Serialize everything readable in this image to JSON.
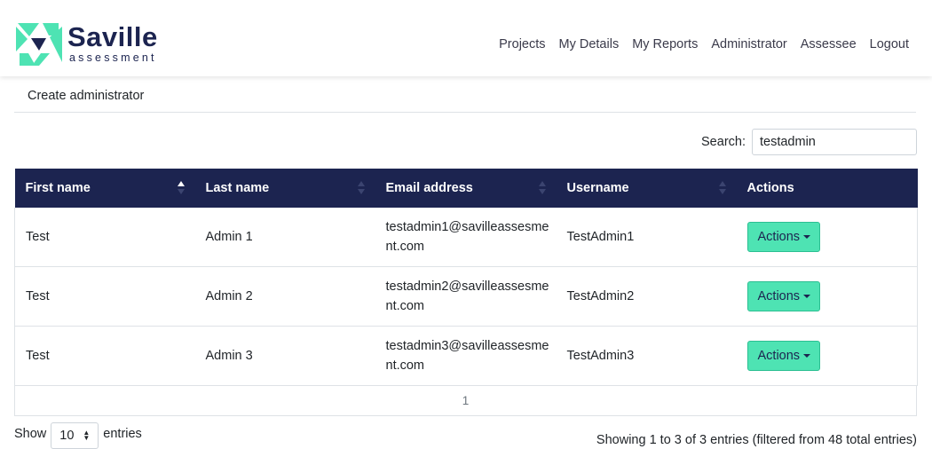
{
  "brand": {
    "name": "Saville",
    "sub": "assessment",
    "accent": "#4ee3b3",
    "navy": "#1c2450"
  },
  "nav": [
    "Projects",
    "My Details",
    "My Reports",
    "Administrator",
    "Assessee",
    "Logout"
  ],
  "breadcrumb": {
    "label": "Create administrator"
  },
  "search": {
    "label": "Search:",
    "value": "testadmin"
  },
  "table": {
    "headers": [
      "First name",
      "Last name",
      "Email address",
      "Username",
      "Actions"
    ],
    "sort_icons": [
      "sort-asc-icon",
      "sort-both-icon",
      "sort-both-icon",
      "sort-both-icon"
    ],
    "rows": [
      {
        "first": "Test",
        "last": "Admin 1",
        "email_line1": "testadmin1@savilleassesme",
        "email_line2": "nt.com",
        "username": "TestAdmin1",
        "action": "Actions"
      },
      {
        "first": "Test",
        "last": "Admin 2",
        "email_line1": "testadmin2@savilleassesme",
        "email_line2": "nt.com",
        "username": "TestAdmin2",
        "action": "Actions"
      },
      {
        "first": "Test",
        "last": "Admin 3",
        "email_line1": "testadmin3@savilleassesme",
        "email_line2": "nt.com",
        "username": "TestAdmin3",
        "action": "Actions"
      }
    ]
  },
  "pagination": {
    "current_page": "1"
  },
  "footer": {
    "show_label": "Show",
    "page_size": "10",
    "entries_label": "entries",
    "info": "Showing 1 to 3 of 3 entries (filtered from 48 total entries)"
  }
}
